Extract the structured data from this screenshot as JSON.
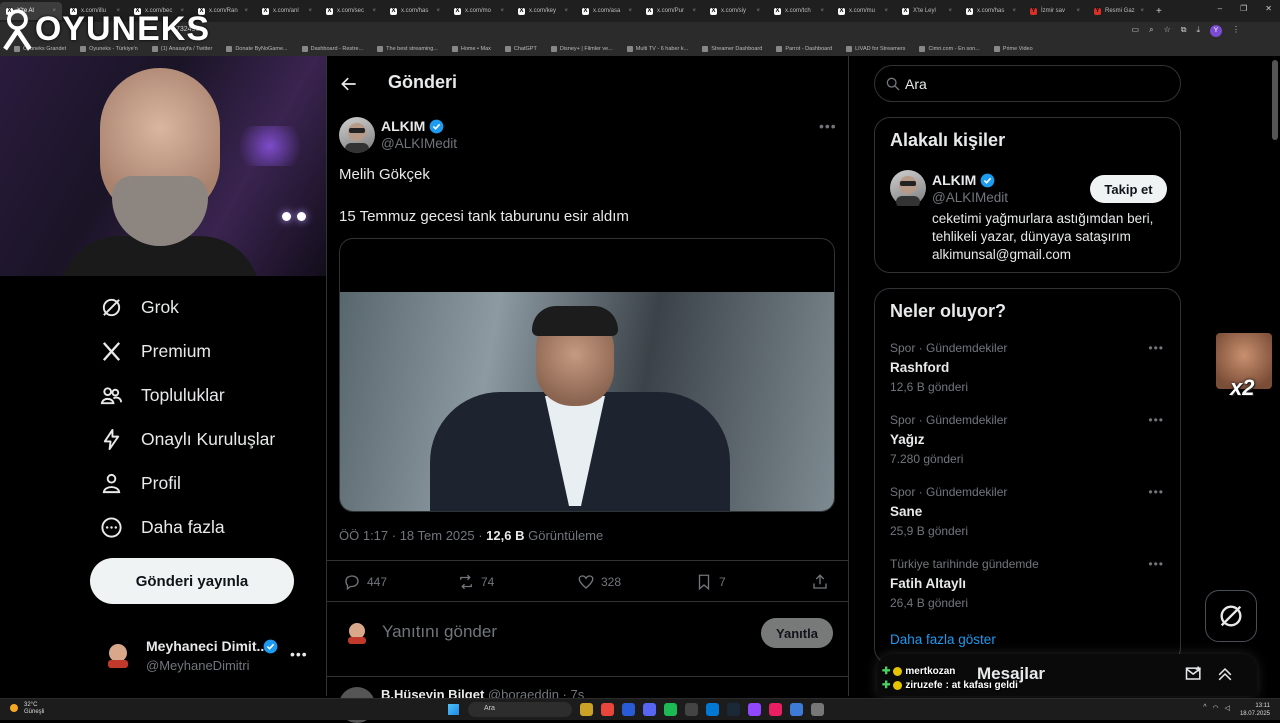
{
  "browser": {
    "tabs": [
      {
        "label": "X'te Al",
        "favicon": "X",
        "active": true
      },
      {
        "label": "x.com/illu",
        "favicon": "X"
      },
      {
        "label": "x.com/bec",
        "favicon": "X"
      },
      {
        "label": "x.com/Ran",
        "favicon": "X"
      },
      {
        "label": "x.com/anl",
        "favicon": "X"
      },
      {
        "label": "x.com/sec",
        "favicon": "X"
      },
      {
        "label": "x.com/has",
        "favicon": "X"
      },
      {
        "label": "x.com/mo",
        "favicon": "X"
      },
      {
        "label": "x.com/key",
        "favicon": "X"
      },
      {
        "label": "x.com/asa",
        "favicon": "X"
      },
      {
        "label": "x.com/Pur",
        "favicon": "X"
      },
      {
        "label": "x.com/siy",
        "favicon": "X"
      },
      {
        "label": "x.com/tch",
        "favicon": "X"
      },
      {
        "label": "x.com/mu",
        "favicon": "X"
      },
      {
        "label": "X'te Leyl",
        "favicon": "X"
      },
      {
        "label": "x.com/has",
        "favicon": "X"
      },
      {
        "label": "İzmir sav",
        "favicon": "Y",
        "red": true
      },
      {
        "label": "Resmi Gaz",
        "favicon": "Y",
        "red": true
      }
    ],
    "new_tab": "+",
    "url_fragment": "732491",
    "bookmarks": [
      "Oyuneks Grandet",
      "Oyuneks - Türkiye'n",
      "(1) Anasayfa / Twitter",
      "Donate ByNoGame...",
      "Dashboard - Restre...",
      "The best streaming...",
      "Home • Max",
      "ChatGPT",
      "Disney+ | Filmler ve...",
      "Multi TV - 6 haber k...",
      "Streamer Dashboard",
      "Parrot - Dashboard",
      "LIVAD for Streamers",
      "Cimri.com - En son...",
      "Prime Video"
    ],
    "window_controls": [
      "–",
      "❐",
      "✕"
    ],
    "profile_initial": "Y"
  },
  "overlay": {
    "logo_text": "OYUNEKS",
    "emote_text": "x2"
  },
  "nav": {
    "items": [
      {
        "label": "Grok",
        "icon": "grok-icon"
      },
      {
        "label": "Premium",
        "icon": "x-premium-icon"
      },
      {
        "label": "Topluluklar",
        "icon": "communities-icon"
      },
      {
        "label": "Onaylı Kuruluşlar",
        "icon": "lightning-icon"
      },
      {
        "label": "Profil",
        "icon": "profile-icon"
      },
      {
        "label": "Daha fazla",
        "icon": "more-circle-icon"
      }
    ],
    "post_button": "Gönderi yayınla",
    "account": {
      "name": "Meyhaneci Dimit...",
      "handle": "@MeyhaneDimitri",
      "more": "•••"
    }
  },
  "main": {
    "title": "Gönderi",
    "tweet": {
      "name": "ALKIM",
      "handle": "@ALKIMedit",
      "more": "•••",
      "line1": "Melih Gökçek",
      "line2": "15 Temmuz gecesi tank taburunu esir aldım",
      "time": "ÖÖ 1:17 · 18 Tem 2025 · ",
      "views_count": "12,6 B",
      "views_label": " Görüntüleme",
      "replies": "447",
      "reposts": "74",
      "likes": "328",
      "bookmarks": "7"
    },
    "reply": {
      "placeholder": "Yanıtını gönder",
      "button": "Yanıtla"
    },
    "next_tweet": {
      "name": "B.Hüseyin Bilget",
      "handle": "@boraeddin · 7s"
    }
  },
  "right": {
    "search_placeholder": "Ara",
    "related": {
      "heading": "Alakalı kişiler",
      "name": "ALKIM",
      "handle": "@ALKIMedit",
      "follow": "Takip et",
      "bio": "ceketimi yağmurlara astığımdan beri, tehlikeli yazar, dünyaya sataşırım alkimunsal@gmail.com"
    },
    "trends": {
      "heading": "Neler oluyor?",
      "items": [
        {
          "context": "Spor · Gündemdekiler",
          "topic": "Rashford",
          "count": "12,6 B gönderi"
        },
        {
          "context": "Spor · Gündemdekiler",
          "topic": "Yağız",
          "count": "7.280 gönderi"
        },
        {
          "context": "Spor · Gündemdekiler",
          "topic": "Sane",
          "count": "25,9 B gönderi"
        },
        {
          "context": "Türkiye tarihinde gündemde",
          "topic": "Fatih Altaylı",
          "count": "26,4 B gönderi"
        }
      ],
      "show_more": "Daha fazla göster"
    },
    "messages_title": "Mesajlar"
  },
  "chat": [
    {
      "user": "mertkozan",
      "message": ""
    },
    {
      "user": "ziruzefe",
      "message": ": at kafası geldi"
    }
  ],
  "taskbar": {
    "weather_temp": "32°C",
    "weather_text": "Güneşli",
    "search": "Ara",
    "time": "13:11",
    "date": "18.07.2025"
  },
  "colors": {
    "accent": "#1d9bf0",
    "background": "#000000",
    "border": "#2f3336",
    "muted": "#71767b"
  }
}
